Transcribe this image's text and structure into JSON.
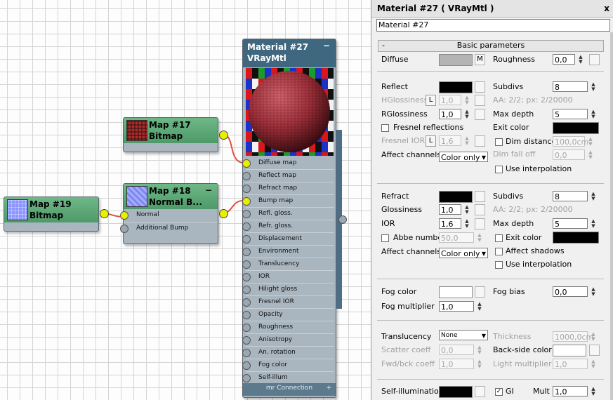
{
  "nodes": {
    "map17": {
      "title": "Map #17",
      "subtitle": "Bitmap"
    },
    "map18": {
      "title": "Map #18",
      "subtitle": "Normal B...",
      "slots": [
        "Normal",
        "Additional Bump"
      ]
    },
    "map19": {
      "title": "Map #19",
      "subtitle": "Bitmap"
    },
    "material": {
      "title": "Material #27",
      "subtitle": "VRayMtl",
      "minimize": "−",
      "slots": [
        "Diffuse map",
        "Reflect map",
        "Refract map",
        "Bump map",
        "Refl. gloss.",
        "Refr. gloss.",
        "Displacement",
        "Environment",
        "Translucency",
        "IOR",
        "Hilight gloss",
        "Fresnel IOR",
        "Opacity",
        "Roughness",
        "Anisotropy",
        "An. rotation",
        "Fog color",
        "Self-illum"
      ],
      "footer": "mr Connection"
    }
  },
  "panel": {
    "title": "Material #27  ( VRayMtl )",
    "close": "x",
    "name": "Material #27",
    "rollout": "Basic parameters",
    "rollout_toggle": "-",
    "diffuse": {
      "label": "Diffuse",
      "map_btn": "M",
      "roughness_label": "Roughness",
      "roughness": "0,0",
      "color": "#b4b4b4"
    },
    "reflect": {
      "label": "Reflect",
      "color": "#000000",
      "hgloss_label": "HGlossiness",
      "hgloss_lock": "L",
      "hgloss": "1,0",
      "rgloss_label": "RGlossiness",
      "rgloss": "1,0",
      "fresnel_label": "Fresnel reflections",
      "fresnel_ior_label": "Fresnel IOR",
      "fresnel_ior_lock": "L",
      "fresnel_ior": "1,6",
      "affect_label": "Affect channels",
      "affect": "Color only",
      "subdivs_label": "Subdivs",
      "subdivs": "8",
      "aa": "AA: 2/2; px: 2/20000",
      "maxdepth_label": "Max depth",
      "maxdepth": "5",
      "exit_label": "Exit color",
      "exit_color": "#000000",
      "dim_label": "Dim distance",
      "dim": "100,0cm",
      "falloff_label": "Dim fall off",
      "falloff": "0,0",
      "interp_label": "Use interpolation"
    },
    "refract": {
      "label": "Refract",
      "color": "#000000",
      "gloss_label": "Glossiness",
      "gloss": "1,0",
      "ior_label": "IOR",
      "ior": "1,6",
      "abbe_label": "Abbe number",
      "abbe": "50,0",
      "affect_label": "Affect channels",
      "affect": "Color only",
      "subdivs_label": "Subdivs",
      "subdivs": "8",
      "aa": "AA: 2/2; px: 2/20000",
      "maxdepth_label": "Max depth",
      "maxdepth": "5",
      "exit_label": "Exit color",
      "exit_color": "#000000",
      "shadows_label": "Affect shadows",
      "interp_label": "Use interpolation"
    },
    "fog": {
      "color_label": "Fog color",
      "color": "#ffffff",
      "mult_label": "Fog multiplier",
      "mult": "1,0",
      "bias_label": "Fog bias",
      "bias": "0,0"
    },
    "translucency": {
      "label": "Translucency",
      "mode": "None",
      "scatter_label": "Scatter coeff",
      "scatter": "0,0",
      "fwd_label": "Fwd/bck coeff",
      "fwd": "1,0",
      "thickness_label": "Thickness",
      "thickness": "1000,0cm",
      "backside_label": "Back-side color",
      "backside_color": "#ffffff",
      "light_label": "Light multiplier",
      "light": "1,0"
    },
    "selfillum": {
      "label": "Self-illumination",
      "color": "#000000",
      "gi_label": "GI",
      "mult_label": "Mult",
      "mult": "1,0"
    }
  }
}
